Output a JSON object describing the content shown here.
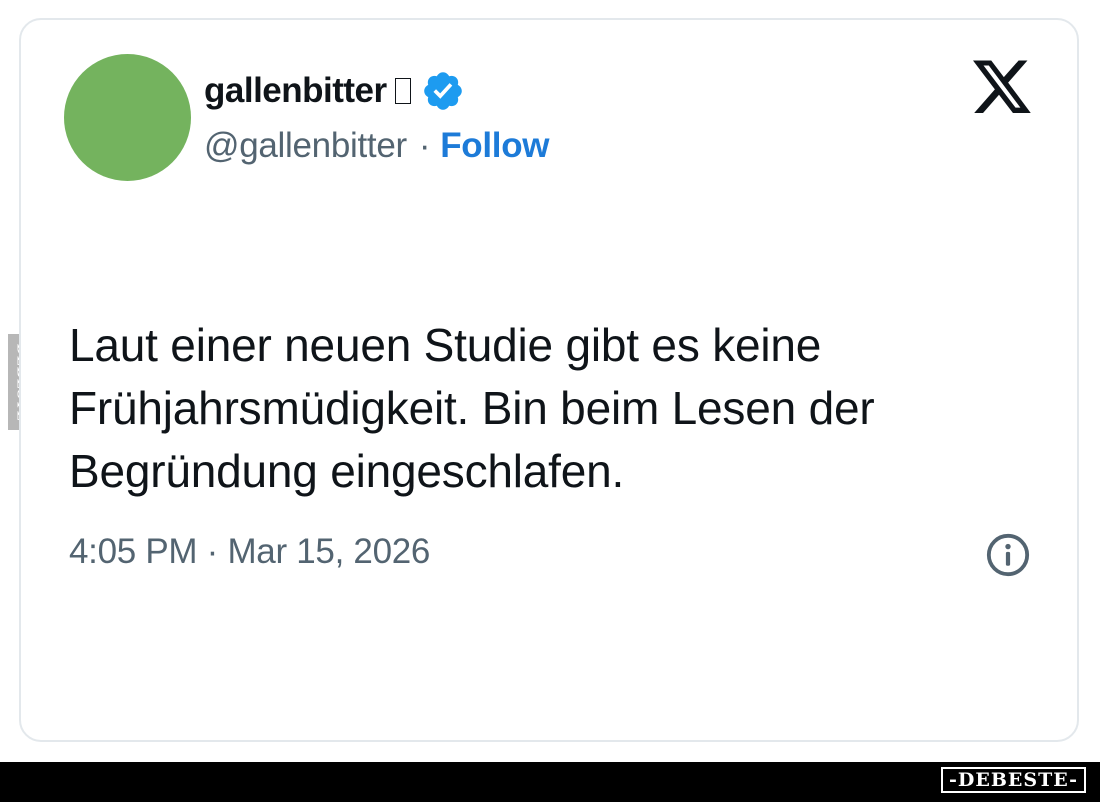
{
  "tweet": {
    "display_name": "gallenbitter",
    "name_emoji": "missing-glyph-box",
    "verified_badge": "verified-badge-icon",
    "handle": "@gallenbitter",
    "separator": "·",
    "follow_label": "Follow",
    "text_lines": [
      "Laut einer neuen Studie gibt es keine",
      "Frühjahrsmüdigkeit. Bin beim Lesen der",
      "Begründung eingeschlafen."
    ],
    "timestamp": "4:05 PM · Mar 15, 2026",
    "platform_logo": "x-logo-icon",
    "info_icon": "info-icon"
  },
  "watermark": {
    "side_text": "DEBESTE",
    "footer_brand": "-DEBESTE-"
  },
  "colors": {
    "text_primary": "#0f1419",
    "text_secondary": "#536471",
    "follow_blue": "#1d7bd8",
    "verified_blue": "#1d9bf0",
    "avatar_green": "#74b35e",
    "card_border": "#e3e8ec",
    "footer_bg": "#000000"
  }
}
